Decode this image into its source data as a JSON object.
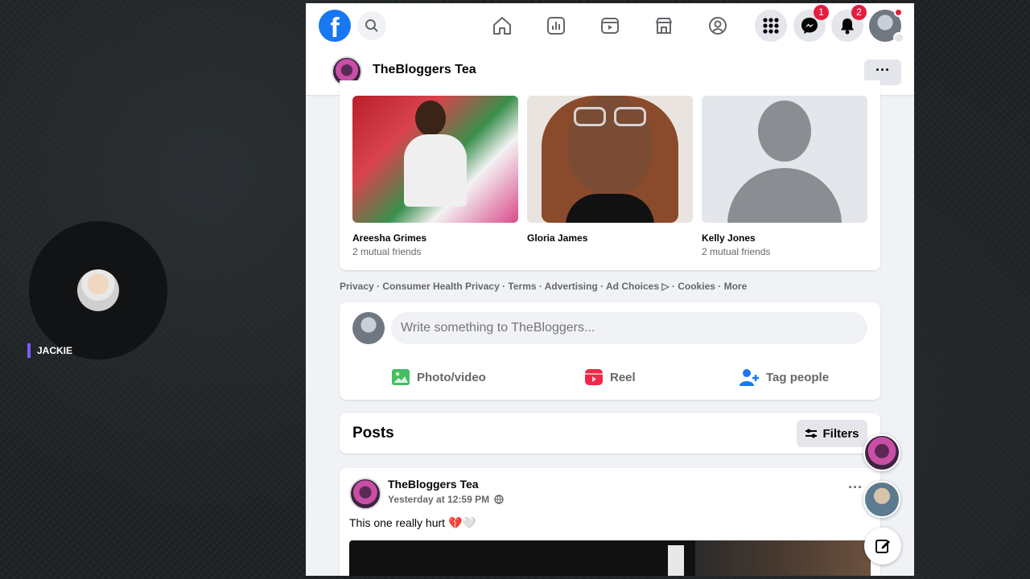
{
  "overlay": {
    "streamer_name": "JACKIE"
  },
  "topbar": {
    "logo": "f",
    "messenger_badge": "1",
    "notifications_badge": "2",
    "colors": {
      "brand": "#1877f2",
      "badge": "#e41e3f"
    }
  },
  "page": {
    "name": "TheBloggers Tea",
    "more_label": "···"
  },
  "friends": [
    {
      "name": "Areesha Grimes",
      "mutual": "2 mutual friends"
    },
    {
      "name": "Gloria James",
      "mutual": ""
    },
    {
      "name": "Kelly Jones",
      "mutual": "2 mutual friends"
    }
  ],
  "footer": {
    "links": "Privacy · Consumer Health Privacy · Terms · Advertising · Ad Choices ▷ · Cookies · More"
  },
  "composer": {
    "placeholder": "Write something to TheBloggers...",
    "photo_label": "Photo/video",
    "reel_label": "Reel",
    "tag_label": "Tag people"
  },
  "posts": {
    "title": "Posts",
    "filters_label": "Filters"
  },
  "post": {
    "author": "TheBloggers Tea",
    "time": "Yesterday at 12:59 PM",
    "text": "This one really hurt 💔🤍",
    "dots": "···"
  },
  "icons": [
    "facebook-logo-icon",
    "search-icon",
    "home-icon",
    "chart-icon",
    "video-icon",
    "marketplace-icon",
    "groups-icon",
    "menu-grid-icon",
    "messenger-icon",
    "bell-icon",
    "globe-icon",
    "filters-icon",
    "edit-icon"
  ]
}
